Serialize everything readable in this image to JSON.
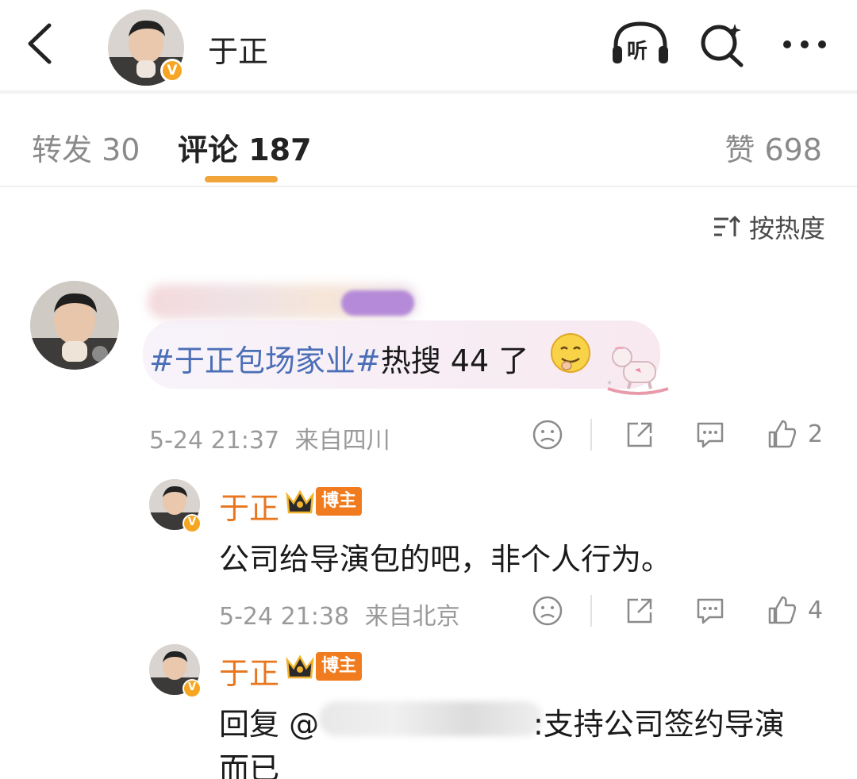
{
  "header": {
    "title": "于正",
    "listen_label": "听",
    "verified_mark": "V",
    "icons": [
      "back-arrow-icon",
      "listen-headphone-icon",
      "search-icon",
      "more-icon"
    ]
  },
  "tabs": {
    "repost": "转发 30",
    "comment": "评论 187",
    "like": "赞 698",
    "active": "comment",
    "accent_color": "#f0a43a"
  },
  "sort": {
    "label": "按热度",
    "icon": "sort-icon"
  },
  "comments": [
    {
      "user_name_visible": "",
      "text_topic": "#于正包场家业#",
      "text_rest": "热搜 44 了",
      "emoji": "drooling-face-emoji",
      "sticker": "rocking-horse-sticker",
      "time": "5-24 21:37",
      "location": "来自四川",
      "likes": "2",
      "replies": [
        {
          "name": "于正",
          "badge": "博主",
          "text": "公司给导演包的吧，非个人行为。",
          "time": "5-24 21:38",
          "location": "来自北京",
          "likes": "4"
        },
        {
          "name": "于正",
          "badge": "博主",
          "text_prefix": "回复 @",
          "text_suffix": ":支持公司签约导演",
          "text_line2": "而已"
        }
      ]
    }
  ],
  "colors": {
    "name_orange": "#e8761e",
    "topic_blue": "#4b6fb7",
    "meta_gray": "#9a9a9a"
  }
}
